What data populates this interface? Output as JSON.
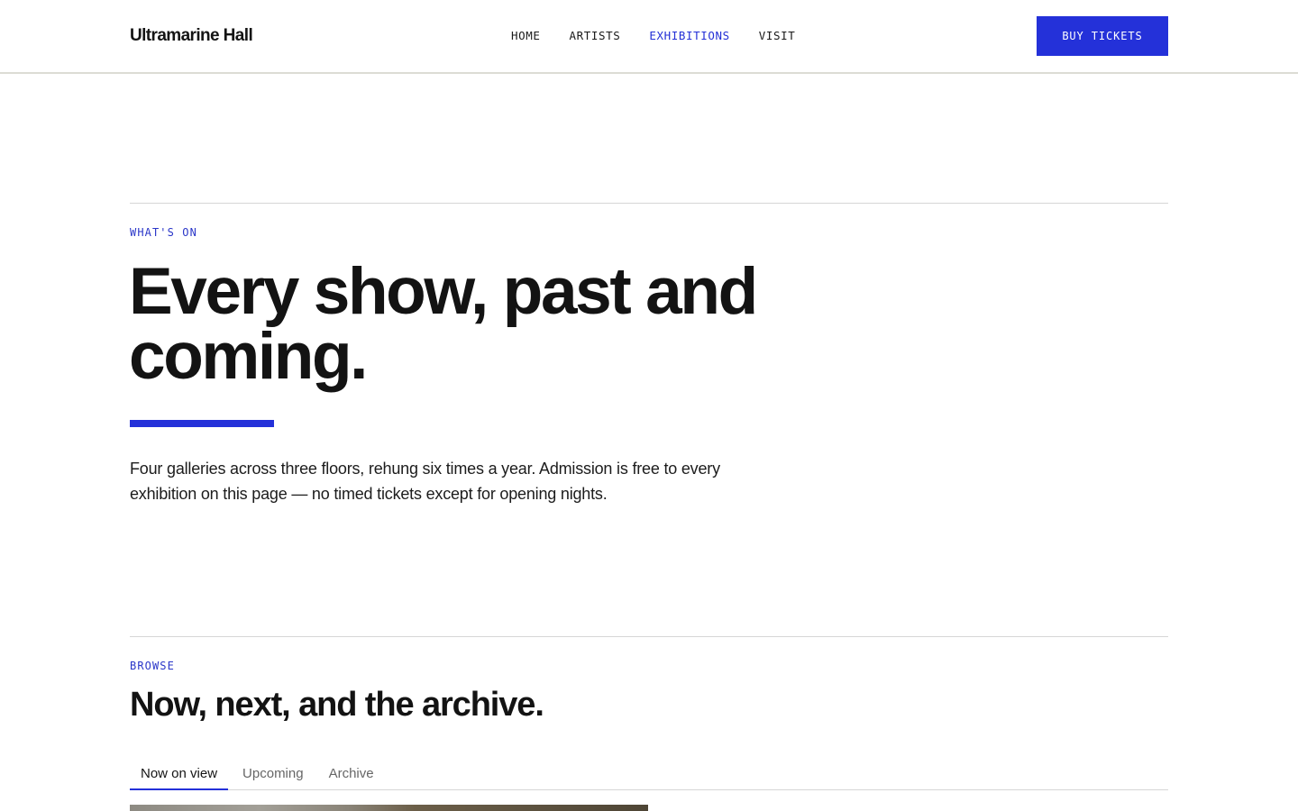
{
  "header": {
    "logo": "Ultramarine Hall",
    "nav": [
      {
        "label": "HOME",
        "active": false
      },
      {
        "label": "ARTISTS",
        "active": false
      },
      {
        "label": "EXHIBITIONS",
        "active": true
      },
      {
        "label": "VISIT",
        "active": false
      }
    ],
    "cta_label": "BUY TICKETS"
  },
  "hero": {
    "eyebrow": "WHAT'S ON",
    "title_line1": "Every show, past and",
    "title_line2": "coming.",
    "lede": "Four galleries across three floors, rehung six times a year. Admission is free to every exhibition on this page — no timed tickets except for opening nights."
  },
  "browse": {
    "eyebrow": "BROWSE",
    "title": "Now, next, and the archive.",
    "tabs": [
      {
        "label": "Now on view",
        "active": true
      },
      {
        "label": "Upcoming",
        "active": false
      },
      {
        "label": "Archive",
        "active": false
      }
    ]
  },
  "colors": {
    "accent": "#2431d9",
    "text": "#141414",
    "divider": "#d6d6d6",
    "background": "#ffffff"
  }
}
